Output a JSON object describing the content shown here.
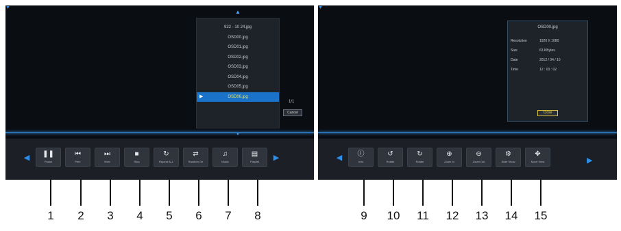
{
  "left_screen": {
    "file_list": {
      "items": [
        "922 - 10 24.jpg",
        "OSD00.jpg",
        "OSD01.jpg",
        "OSD02.jpg",
        "OSD03.jpg",
        "OSD04.jpg",
        "OSD05.jpg",
        "OSD06.jpg"
      ],
      "selected_index": 7
    },
    "page_count": "1/1",
    "cancel_label": "Cancel",
    "toolbar": [
      {
        "label": "Pause",
        "icon": "pause-icon",
        "glyph": "❚❚"
      },
      {
        "label": "Prev.",
        "icon": "previous-icon",
        "glyph": "⏮"
      },
      {
        "label": "Next",
        "icon": "next-icon",
        "glyph": "⏭"
      },
      {
        "label": "Stop",
        "icon": "stop-icon",
        "glyph": "■"
      },
      {
        "label": "Repeat ALL",
        "icon": "repeat-icon",
        "glyph": "↻"
      },
      {
        "label": "Random On",
        "icon": "random-icon",
        "glyph": "⇄"
      },
      {
        "label": "Music",
        "icon": "music-icon",
        "glyph": "♫"
      },
      {
        "label": "Playlist",
        "icon": "playlist-icon",
        "glyph": "▤"
      }
    ]
  },
  "right_screen": {
    "info_panel": {
      "title": "OSD00.jpg",
      "rows": [
        {
          "key": "Resolution",
          "value": "1920 X 1080"
        },
        {
          "key": "Size",
          "value": "63 KBytes"
        },
        {
          "key": "Date",
          "value": "2012 / 04 / 10"
        },
        {
          "key": "Time",
          "value": "12 : 03 : 02"
        }
      ],
      "close_label": "Close"
    },
    "toolbar": [
      {
        "label": "Info",
        "icon": "info-icon",
        "glyph": "ⓘ"
      },
      {
        "label": "Rotate",
        "icon": "rotate-left-icon",
        "glyph": "↺"
      },
      {
        "label": "Rotate",
        "icon": "rotate-right-icon",
        "glyph": "↻"
      },
      {
        "label": "Zoom In",
        "icon": "zoom-in-icon",
        "glyph": "⊕"
      },
      {
        "label": "Zoom Out",
        "icon": "zoom-out-icon",
        "glyph": "⊖"
      },
      {
        "label": "Slide Show",
        "icon": "gear-icon",
        "glyph": "⚙"
      },
      {
        "label": "Move View",
        "icon": "move-view-icon",
        "glyph": "✥"
      }
    ]
  },
  "callouts": [
    "1",
    "2",
    "3",
    "4",
    "5",
    "6",
    "7",
    "8",
    "9",
    "10",
    "11",
    "12",
    "13",
    "14",
    "15"
  ]
}
